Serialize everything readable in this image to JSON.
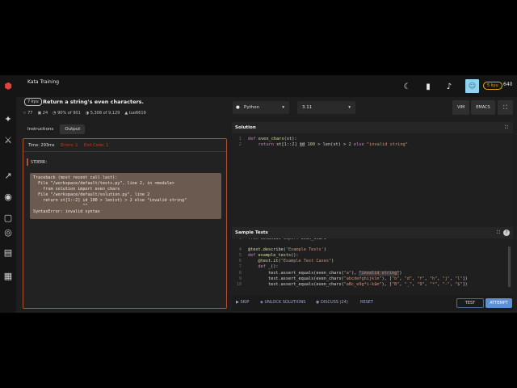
{
  "topbar": {
    "crumb": "Kata Training",
    "avatar_icon": "☺",
    "rank_badge": "5 kyu",
    "honor": "640"
  },
  "kata": {
    "kyu": "7 kyu",
    "title": "Return a string's even characters.",
    "stats": [
      "77",
      "24",
      "90% of 901",
      "5,308 of 9,129",
      "tuo6619"
    ],
    "tabs": [
      "Instructions",
      "Output"
    ],
    "active_tab": "Output"
  },
  "output": {
    "time": "Time: 293ms",
    "errors": "Errors: 1",
    "exit_code": "Exit Code: 1",
    "stderr_label": "STDERR:",
    "stderr": "Traceback (most recent call last):\n  File \"/workspace/default/tests.py\", line 2, in <module>\n    from solution import even_chars\n  File \"/workspace/default/solution.py\", line 2\n    return st[1::2] id 100 > len(st) > 2 else \"invalid string\"\n                    ^^\nSyntaxError: invalid syntax"
  },
  "editor": {
    "language": "Python",
    "version": "3.11",
    "modes": [
      "VIM",
      "EMACS"
    ]
  },
  "solution": {
    "heading": "Solution",
    "line_numbers": [
      "1",
      "2"
    ]
  },
  "tests": {
    "heading": "Sample Tests",
    "line_numbers": [
      "3",
      "4",
      "5",
      "6",
      "7",
      "8",
      "9",
      "10"
    ]
  },
  "bottom": {
    "skip": "SKIP",
    "unlock": "UNLOCK SOLUTIONS",
    "discuss": "DISCUSS (24)",
    "reset": "RESET",
    "test": "TEST",
    "attempt": "ATTEMPT"
  },
  "colors": {
    "error_red": "#c0392b",
    "output_border": "#b0502e",
    "attempt_blue": "#5b8fd6"
  }
}
